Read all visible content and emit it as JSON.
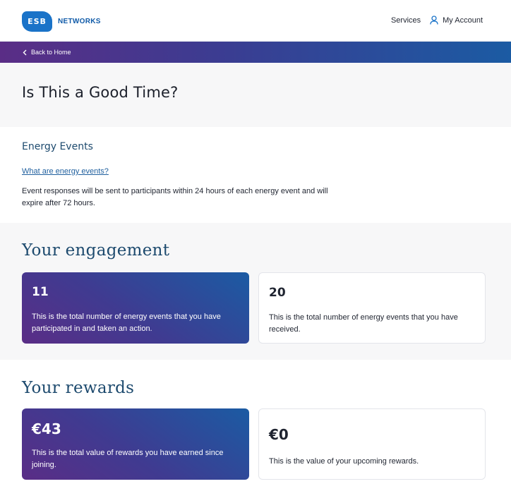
{
  "header": {
    "logo_mark": "ESB",
    "logo_text": "NETWORKS",
    "nav_services": "Services",
    "nav_account": "My Account"
  },
  "back": {
    "label": "Back to Home"
  },
  "hero": {
    "title": "Is This a Good Time?"
  },
  "energy_events": {
    "heading": "Energy Events",
    "link": "What are energy events?",
    "body": "Event responses will be sent to participants within 24 hours of each energy event and will expire after 72 hours."
  },
  "engagement": {
    "heading": "Your engagement",
    "cards": [
      {
        "value": "11",
        "desc": "This is the total number of energy events that you have participated in and taken an action."
      },
      {
        "value": "20",
        "desc": "This is the total number of energy events that you have received."
      }
    ]
  },
  "rewards": {
    "heading": "Your rewards",
    "cards": [
      {
        "value": "€43",
        "desc": "This is the total value of rewards you have earned since joining."
      },
      {
        "value": "€0",
        "desc": "This is the value of your upcoming rewards."
      }
    ]
  },
  "colors": {
    "brand_blue": "#1a73c8",
    "heading_navy": "#1d4a6e",
    "gradient_purple": "#5a2d86",
    "gradient_blue": "#1b5ba3"
  },
  "icons": [
    "user-icon",
    "chevron-left-icon"
  ]
}
